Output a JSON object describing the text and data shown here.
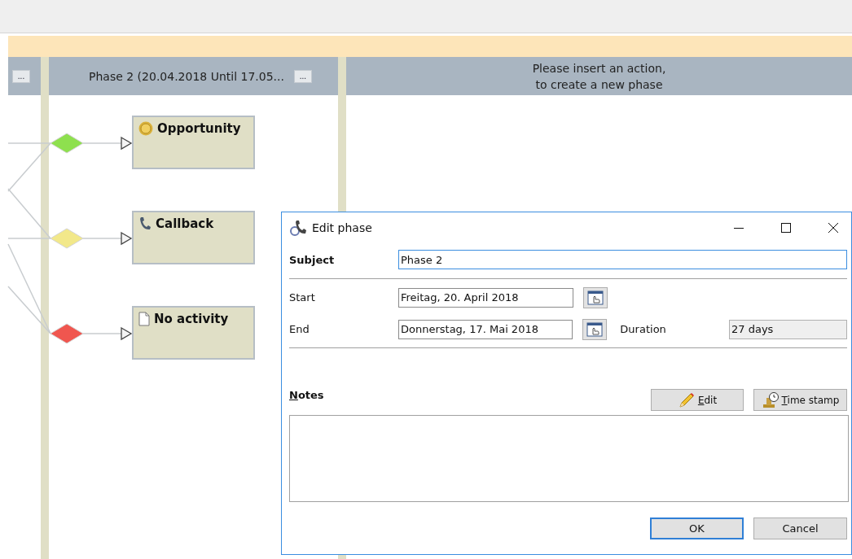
{
  "lanes": [
    {
      "menu": "..."
    },
    {
      "title": "Phase 2 (20.04.2018 Until 17.05...",
      "menu": "..."
    }
  ],
  "new_phase_hint": "Please insert an action,\nto create a new phase",
  "nodes": [
    {
      "label": "Opportunity",
      "kind": "opportunity",
      "color": "#8ee04e"
    },
    {
      "label": "Callback",
      "kind": "callback",
      "color": "#f2e88a"
    },
    {
      "label": "No activity",
      "kind": "none",
      "color": "#f0564f"
    }
  ],
  "dialog": {
    "title": "Edit phase",
    "subject_label": "Subject",
    "subject": "Phase 2",
    "start_label": "Start",
    "start": "Freitag, 20. April 2018",
    "end_label": "End",
    "end": "Donnerstag, 17. Mai 2018",
    "duration_label": "Duration",
    "duration": "27 days",
    "notes_label": "Notes",
    "edit_button": "Edit",
    "timestamp_button": "Time stamp",
    "ok_button": "OK",
    "cancel_button": "Cancel"
  }
}
